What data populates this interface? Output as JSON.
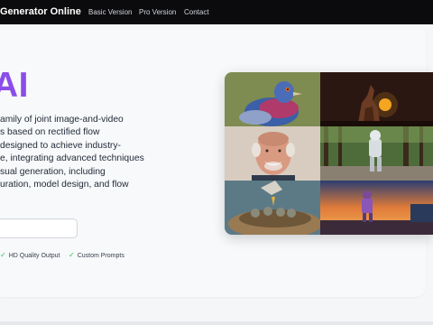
{
  "nav": {
    "brand": "Generator Online",
    "links": [
      "Basic Version",
      "Pro Version",
      "Contact"
    ]
  },
  "hero": {
    "title": "AI",
    "description_lines": [
      "amily of joint image-and-video",
      "s based on rectified flow",
      " designed to achieve industry-",
      "e, integrating advanced techniques",
      "sual generation, including",
      "uration, model design, and flow"
    ],
    "features": [
      "HD Quality Output",
      "Custom Prompts"
    ]
  },
  "gallery": {
    "images": [
      "pigeon-image",
      "wolf-howling-image",
      "smiling-old-man-image",
      "robot-walking-forest-image",
      "baby-birds-nest-image",
      "figure-sunset-image"
    ]
  },
  "colors": {
    "accent": "#8b4dea",
    "check": "#22c55e",
    "nav_bg": "#0b0b0d"
  }
}
